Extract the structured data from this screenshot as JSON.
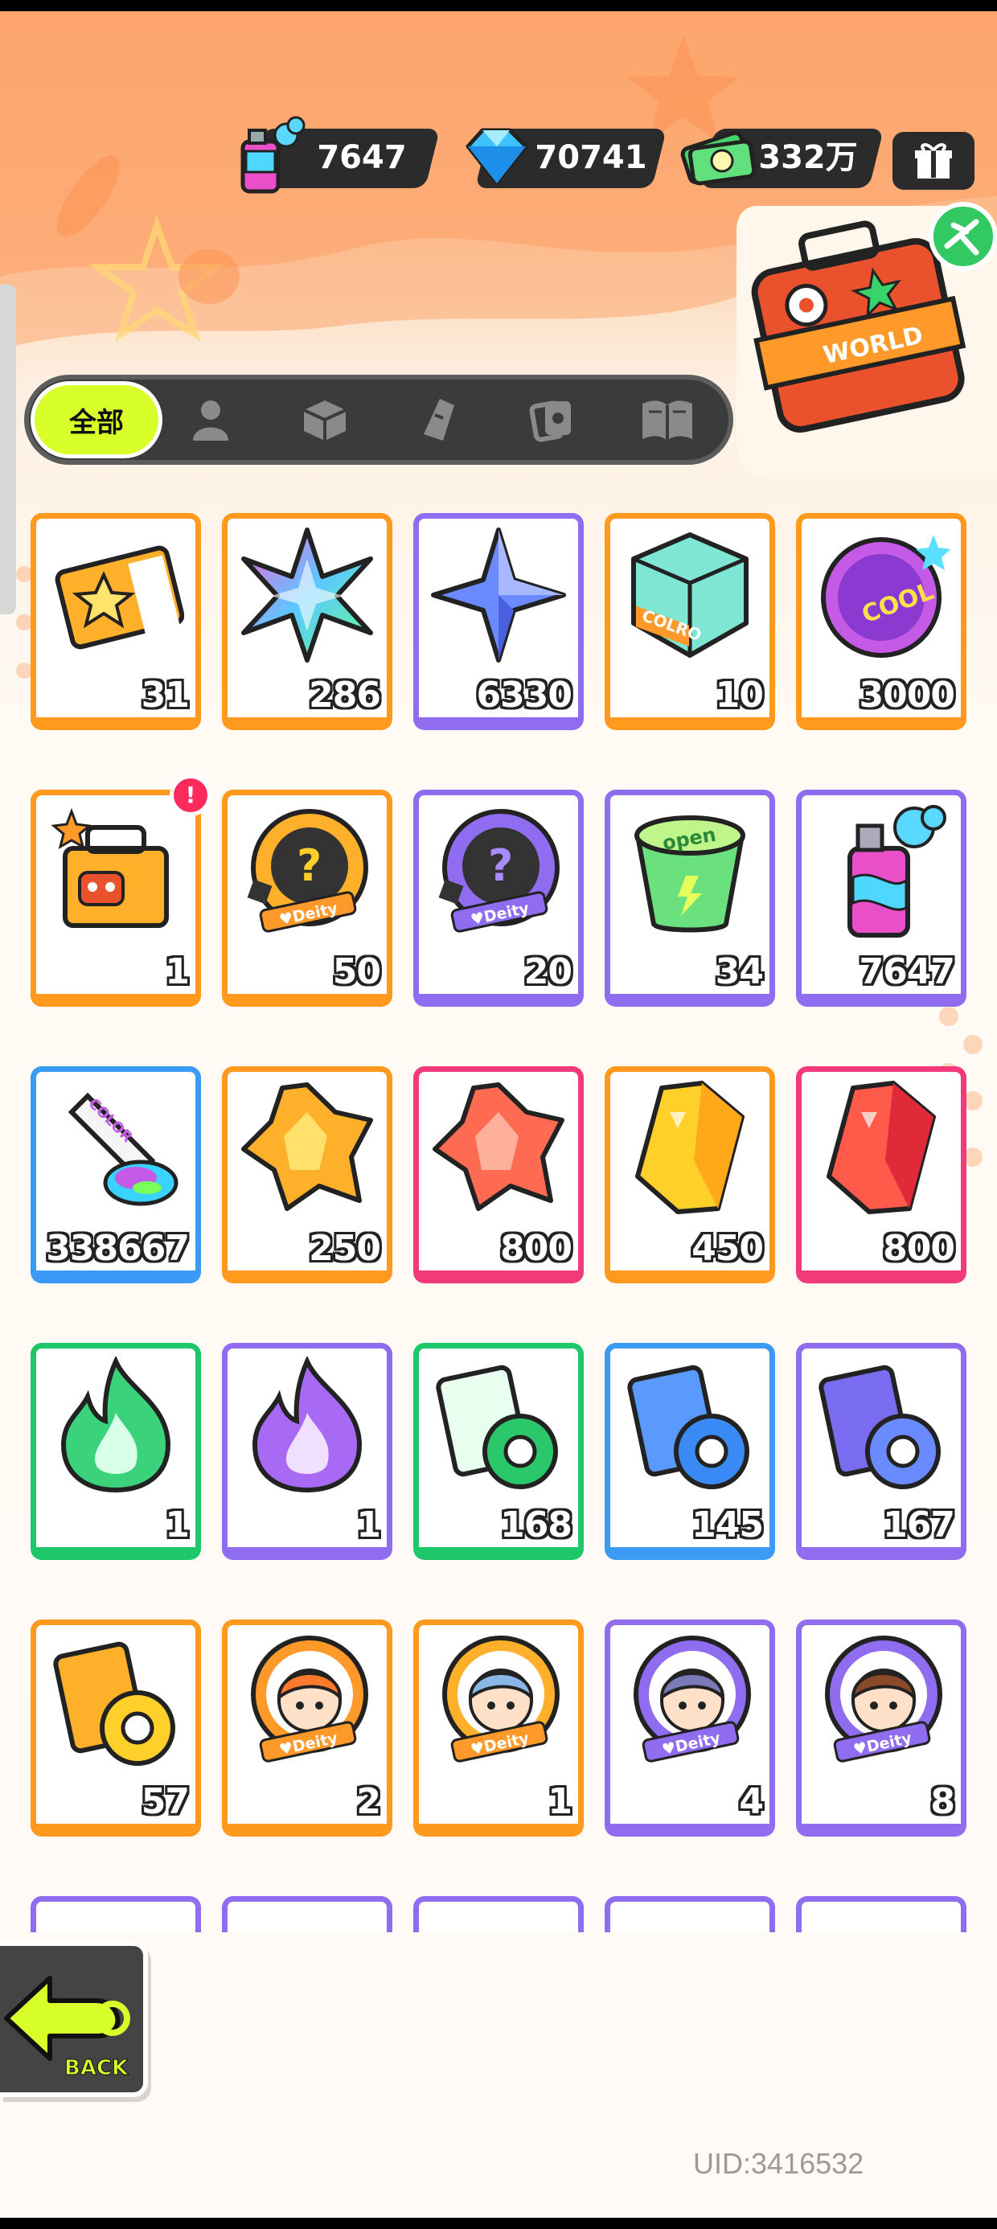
{
  "colors": {
    "orange": "#ff9a1f",
    "purple": "#8f6cf0",
    "blue": "#3a9af5",
    "pink": "#f23a7a",
    "green": "#1ec86a",
    "tab_active": "#d8ff2a",
    "pill": "#2b2b2b"
  },
  "currencies": [
    {
      "icon": "spray-paint-icon",
      "value": "7647"
    },
    {
      "icon": "diamond-icon",
      "value": "70741"
    },
    {
      "icon": "cash-icon",
      "value": "332万"
    }
  ],
  "top_right": {
    "gift_icon": "gift-box-icon",
    "map_icon": "travel-suitcase-world-icon",
    "map_label": "WORLD"
  },
  "tabs": {
    "active_label": "全部",
    "icons": [
      "person-icon",
      "box-icon",
      "spray-can-icon",
      "cards-icon",
      "book-icon"
    ]
  },
  "items": [
    {
      "icon": "ticket-icon",
      "count": "31",
      "border": "orange"
    },
    {
      "icon": "rainbow-star-icon",
      "count": "286",
      "border": "orange"
    },
    {
      "icon": "blue-star-icon",
      "count": "6330",
      "border": "purple"
    },
    {
      "icon": "color-cube-icon",
      "count": "10",
      "border": "orange",
      "text": "COLRO"
    },
    {
      "icon": "cool-badge-icon",
      "count": "3000",
      "border": "orange",
      "text": "COOL"
    },
    {
      "icon": "color-cool-box-icon",
      "count": "1",
      "border": "orange",
      "badge": "!"
    },
    {
      "icon": "mystery-deity-gold-icon",
      "count": "50",
      "border": "orange",
      "text": "Deity"
    },
    {
      "icon": "mystery-deity-purple-icon",
      "count": "20",
      "border": "purple",
      "text": "Deity"
    },
    {
      "icon": "green-drink-icon",
      "count": "34",
      "border": "purple",
      "text": "open"
    },
    {
      "icon": "spray-can-icon",
      "count": "7647",
      "border": "purple"
    },
    {
      "icon": "paint-tube-icon",
      "count": "338667",
      "border": "blue",
      "text": "COLOR"
    },
    {
      "icon": "orange-crystal-icon",
      "count": "250",
      "border": "orange"
    },
    {
      "icon": "red-crystal-icon",
      "count": "800",
      "border": "pink"
    },
    {
      "icon": "yellow-gem-icon",
      "count": "450",
      "border": "orange"
    },
    {
      "icon": "red-gem-icon",
      "count": "800",
      "border": "pink"
    },
    {
      "icon": "green-flame-icon",
      "count": "1",
      "border": "green"
    },
    {
      "icon": "purple-flame-icon",
      "count": "1",
      "border": "purple"
    },
    {
      "icon": "green-card-roll-icon",
      "count": "168",
      "border": "green"
    },
    {
      "icon": "blue-card-roll-icon",
      "count": "145",
      "border": "blue"
    },
    {
      "icon": "purple-card-roll-icon",
      "count": "167",
      "border": "purple"
    },
    {
      "icon": "gold-card-roll-icon",
      "count": "57",
      "border": "orange"
    },
    {
      "icon": "deity-orange-hair-icon",
      "count": "2",
      "border": "orange",
      "text": "Deity"
    },
    {
      "icon": "deity-blue-hair-icon",
      "count": "1",
      "border": "orange",
      "text": "Deity"
    },
    {
      "icon": "deity-purple-hair-icon",
      "count": "4",
      "border": "purple",
      "text": "Deity"
    },
    {
      "icon": "deity-brown-hair-icon",
      "count": "8",
      "border": "purple",
      "text": "Deity"
    }
  ],
  "partial_row_borders": [
    "purple",
    "purple",
    "purple",
    "purple",
    "purple"
  ],
  "back": {
    "label": "BACK",
    "icon": "back-arrow-icon"
  },
  "uid": "UID:3416532"
}
